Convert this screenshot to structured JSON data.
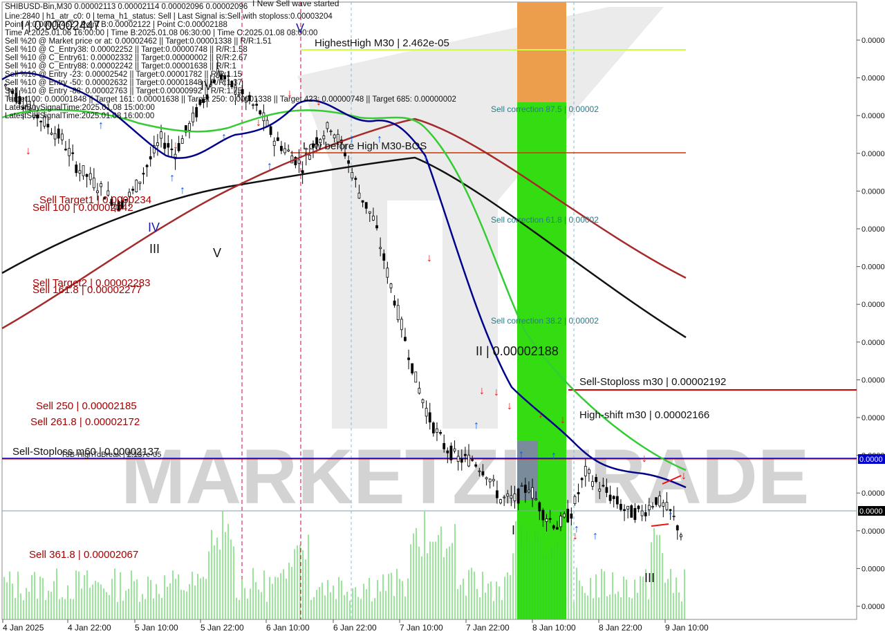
{
  "chart_data": {
    "type": "candlestick",
    "symbol_line": "SHIBUSD-Bin,M30  0.00002113  0.00002114  0.00002096  0.00002096",
    "info_lines": [
      "Line:2840 | h1_atr_c0: 0 | tema_h1_status: Sell | Last Signal is:Sell with stoploss:0.00003204",
      "Point A:0.00002462 | Point B:0.00002122 | Point C:0.00002188",
      "Time A:2025.01.06 16:00:00 | Time B:2025.01.08 06:30:00 | Time C:2025.01.08 08:00:00",
      "Sell %20 @ Market price or at: 0.00002462 || Target:0.00001338 || R/R:1.51",
      "Sell %10 @ C_Entry38: 0.00002252 || Target:0.00000748 || R/R:1.58",
      "Sell %10 @ C_Entry61: 0.00002332 || Target:0.00000002 || R/R:2.67",
      "Sell %10 @ C_Entry88: 0.00002242 || Target:0.00001638 || R/R:1",
      "Sell %10 @ Entry -23: 0.00002542 || Target:0.00001782 || R/R:1.15",
      "Sell %10 @ Entry -50: 0.00002632 || Target:0.00001848 || R/R:1.37",
      "Sell %10 @ Entry -88: 0.00002763 || Target:0.00000992 || R/R:1.75",
      "Target100: 0.00001848 || Target 161: 0.00001638 || Target 250: 0.00001338 || Target 423: 0.00000748 || Target 685: 0.00000002",
      "LatestBuySignalTime:2025.01.08 15:00:00",
      "LatestSellSignalTime:2025.01.08 16:00:00"
    ],
    "top_label": "I New Sell wave started",
    "x_ticks": [
      "4 Jan 2025",
      "4 Jan 22:00",
      "5 Jan 10:00",
      "5 Jan 22:00",
      "6 Jan 10:00",
      "6 Jan 22:00",
      "7 Jan 10:00",
      "7 Jan 22:00",
      "8 Jan 10:00",
      "8 Jan 22:00",
      "9 Jan 10:00"
    ],
    "y_ticks": [
      "0.0000",
      "0.0000",
      "0.0000",
      "0.0000",
      "0.0000",
      "0.0000",
      "0.0000",
      "0.0000",
      "0.0000",
      "0.0000",
      "0.0000",
      "0.0000",
      "0.0000",
      "0.0000",
      "0.0000",
      "0.0000"
    ],
    "price_tags": [
      "0.0000",
      "0.0000"
    ],
    "y_range": [
      2.04e-05,
      2.5e-05
    ],
    "close_series": [
      2.44e-05,
      2.43e-05,
      2.42e-05,
      2.41e-05,
      2.4e-05,
      2.38e-05,
      2.37e-05,
      2.36e-05,
      2.35e-05,
      2.36e-05,
      2.38e-05,
      2.4e-05,
      2.39e-05,
      2.41e-05,
      2.43e-05,
      2.45e-05,
      2.44e-05,
      2.43e-05,
      2.42e-05,
      2.4e-05,
      2.39e-05,
      2.38e-05,
      2.4e-05,
      2.41e-05,
      2.39e-05,
      2.36e-05,
      2.34e-05,
      2.3e-05,
      2.26e-05,
      2.22e-05,
      2.19e-05,
      2.17e-05,
      2.16e-05,
      2.16e-05,
      2.15e-05,
      2.13e-05,
      2.13e-05,
      2.14e-05,
      2.12e-05,
      2.11e-05,
      2.12e-05,
      2.15e-05,
      2.14e-05,
      2.13e-05,
      2.12e-05,
      2.12e-05,
      2.13e-05,
      2.12e-05,
      2.1e-05
    ],
    "annotations": {
      "highest_high": "HighestHigh   M30 | 2.462e-05",
      "low_before_high": "Low before High   M30-BOS",
      "sell_corr_875": "Sell correction 87.5 | 0.00002",
      "sell_corr_618": "Sell correction 61.8 | 0.00002",
      "sell_corr_382": "Sell correction 38.2 | 0.00002",
      "sell_stoploss_m30": "Sell-Stoploss m30 | 0.00002192",
      "high_shift_m30": "High-shift m30 | 0.00002166",
      "sell_stoploss_m60": "Sell-Stoploss m60 | 0.00002137",
      "t3b_high": "T3B-HighToBreak | 2.137e-05",
      "wave_ii": "II | 0.00002188",
      "sell_target1": "Sell Target1 | 0.0000234",
      "sell_100": "Sell 100 | 0.00002342",
      "sell_target2": "Sell Target2 | 0.00002283",
      "sell_1618": "Sell 161.8 | 0.00002277",
      "sell_250": "Sell  250 | 0.00002185",
      "sell_2618": "Sell  261.8 | 0.00002172",
      "sell_3618": "Sell  361.8 | 0.00002067",
      "wave_i_value": "I | 0.00002447",
      "wave_iv": "IV",
      "wave_iii": "III",
      "wave_v": "V",
      "wave_v_top": "V",
      "wave_i": "I",
      "wave_iii_b": "III",
      "wave_iv_small": "IV",
      "watermark": "MARKETZI TRADE"
    },
    "colors": {
      "candles": "#000000",
      "tema_blue": "#00008b",
      "ema_green": "#33cc33",
      "ma_brown": "#a52a2a",
      "ma_black": "#111111",
      "green_zone": "#33dd11",
      "orange_zone": "#ec9e4c",
      "level_red": "#cc0000",
      "level_yellow": "#ccff44",
      "level_blue": "#0000cc",
      "label_red": "#a50000",
      "volume": "#32cd32"
    },
    "grid": true,
    "legend": "none"
  }
}
